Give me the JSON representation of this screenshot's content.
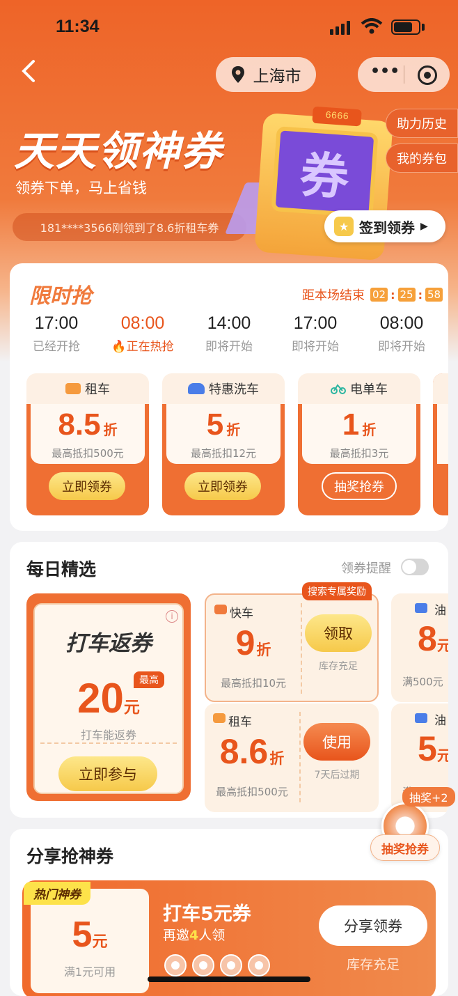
{
  "status_bar": {
    "time": "11:34"
  },
  "nav": {
    "location": "上海市",
    "more_label": "•••"
  },
  "hero": {
    "title": "天天领神券",
    "subtitle": "领券下单，马上省钱",
    "ticker": "181****3566刚领到了8.6折租车券",
    "help_history": "助力历史",
    "my_coupons": "我的券包",
    "signin_label": "签到领券",
    "machine_counter": "6666",
    "machine_glyph": "券"
  },
  "flash_sale": {
    "title": "限时抢",
    "countdown_label": "距本场结束",
    "countdown": [
      "02",
      "25",
      "58"
    ],
    "time_slots": [
      {
        "time": "17:00",
        "status": "已经开抢"
      },
      {
        "time": "08:00",
        "status": "正在热抢"
      },
      {
        "time": "14:00",
        "status": "即将开始"
      },
      {
        "time": "17:00",
        "status": "即将开始"
      },
      {
        "time": "08:00",
        "status": "即将开始"
      }
    ],
    "coupons": [
      {
        "category": "租车",
        "value": "8.5",
        "unit": "折",
        "limit": "最高抵扣500元",
        "button": "立即领券",
        "icon": "rental-car-icon"
      },
      {
        "category": "特惠洗车",
        "value": "5",
        "unit": "折",
        "limit": "最高抵扣12元",
        "button": "立即领券",
        "icon": "car-wash-icon"
      },
      {
        "category": "电单车",
        "value": "1",
        "unit": "折",
        "limit": "最高抵扣3元",
        "button": "抽奖抢券",
        "icon": "ebike-icon"
      }
    ]
  },
  "daily": {
    "title": "每日精选",
    "reminder_label": "领券提醒",
    "reminder_on": false,
    "feature": {
      "title": "打车返券",
      "badge": "最高",
      "value": "20",
      "unit": "元",
      "desc": "打车能返券",
      "button": "立即参与"
    },
    "quick": {
      "tag": "搜索专属奖励",
      "name": "快车",
      "value": "9",
      "unit": "折",
      "limit": "最高抵扣10元",
      "button": "领取",
      "note": "库存充足"
    },
    "rental": {
      "name": "租车",
      "value": "8.6",
      "unit": "折",
      "limit": "最高抵扣500元",
      "button": "使用",
      "note": "7天后过期"
    },
    "fuel_top": {
      "name": "油",
      "value": "8",
      "unit": "元",
      "limit": "满500元"
    },
    "fuel_bottom": {
      "name": "油",
      "value": "5",
      "unit": "元",
      "limit": "满200元"
    }
  },
  "lottery": {
    "badge": "抽奖+2",
    "label": "抽奖抢券"
  },
  "share": {
    "title": "分享抢神券",
    "tag": "热门神券",
    "value": "5",
    "unit": "元",
    "condition": "满1元可用",
    "coupon_title": "打车5元券",
    "invite_prefix": "再邀",
    "invite_count": "4",
    "invite_suffix": "人领",
    "button": "分享领券",
    "stock": "库存充足"
  },
  "colors": {
    "brand": "#ee6428",
    "accent": "#e8551c",
    "gold": "#f6c94a"
  }
}
